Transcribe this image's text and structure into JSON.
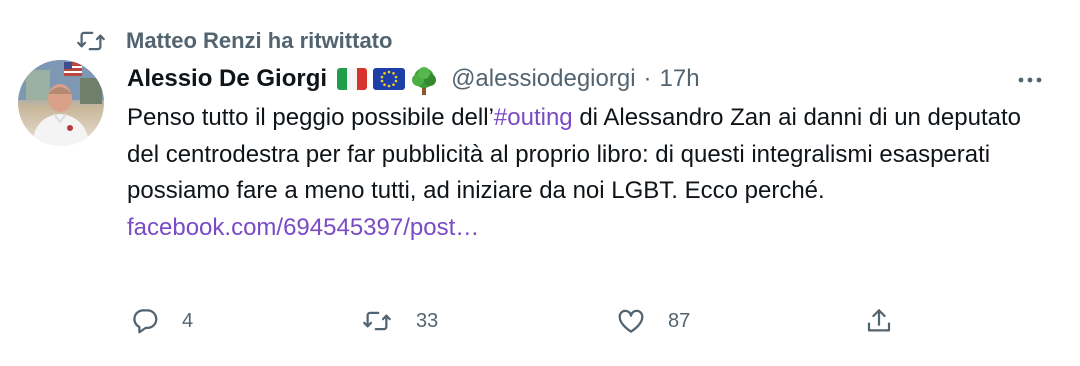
{
  "retweet": {
    "icon": "retweet-icon",
    "text": "Matteo Renzi ha ritwittato"
  },
  "author": {
    "display_name": "Alessio De Giorgi",
    "badges": [
      "italy-flag-emoji",
      "eu-flag-emoji",
      "tree-emoji"
    ],
    "handle": "@alessiodegiorgi",
    "separator": "·",
    "time": "17h"
  },
  "tweet": {
    "text_before": "Penso tutto il peggio possibile dell’",
    "hashtag": "#outing",
    "text_after": " di Alessandro Zan ai danni di un deputato del centrodestra per far pubblicità al proprio libro: di questi integralismi esasperati possiamo fare a meno tutti, ad iniziare da noi LGBT. Ecco perché.",
    "link": "facebook.com/694545397/post…"
  },
  "actions": {
    "replies": "4",
    "retweets": "33",
    "likes": "87"
  },
  "colors": {
    "link": "#794bc4",
    "secondary_text": "#536471",
    "primary_text": "#0f1419"
  }
}
